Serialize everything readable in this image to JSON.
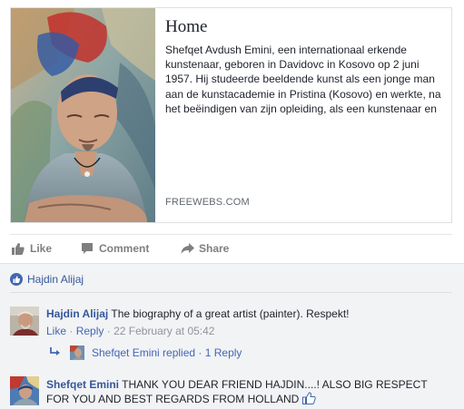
{
  "link_preview": {
    "title": "Home",
    "description": "Shefqet Avdush Emini, een internationaal erkende kunstenaar, geboren in Davidovc in Kosovo op 2 juni 1957. Hij studeerde beeldende kunst als een jonge man aan de kunstacademie in Pristina (Kosovo) en werkte, na het beëindigen van zijn opleiding, als een kunstenaar en",
    "domain": "FREEWEBS.COM",
    "image_icon": "portrait-photo"
  },
  "actions": {
    "like_label": "Like",
    "comment_label": "Comment",
    "share_label": "Share"
  },
  "likes": {
    "icon": "thumbs-up-icon",
    "names": "Hajdin Alijaj"
  },
  "comments": [
    {
      "author": "Hajdin Alijaj",
      "text": "The biography of a great artist (painter). Respekt!",
      "like_label": "Like",
      "separator": "·",
      "reply_label": "Reply",
      "timestamp": "22 February at 05:42",
      "reply_summary": {
        "icon": "reply-arrow-icon",
        "text": "Shefqet Emini replied · 1 Reply"
      }
    },
    {
      "author": "Shefqet Emini",
      "text": "THANK YOU DEAR FRIEND HAJDIN....! ALSO BIG RESPECT FOR YOU AND BEST REGARDS FROM HOLLAND",
      "trailing_icon": "thumbs-up-emoji-icon"
    }
  ],
  "colors": {
    "link_blue": "#365899",
    "meta_grey": "#90949c",
    "comments_bg": "#f2f3f5",
    "brand_blue": "#4267b2"
  }
}
